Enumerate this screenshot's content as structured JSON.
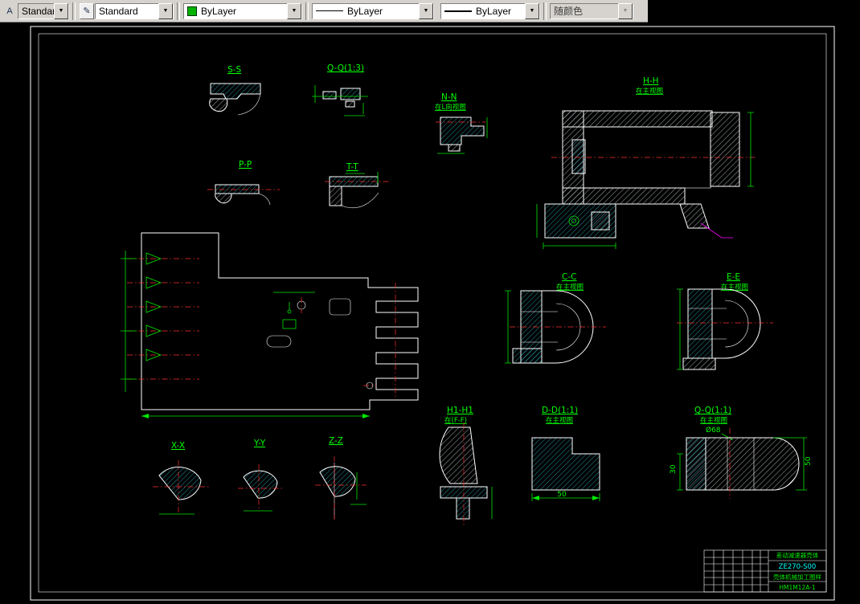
{
  "toolbar": {
    "text_style": {
      "value": "Standard"
    },
    "dim_style": {
      "value": "Standard"
    },
    "color": {
      "value": "ByLayer",
      "swatch": "#00b400"
    },
    "linetype": {
      "value": "ByLayer"
    },
    "lineweight": {
      "value": "ByLayer"
    },
    "plot_style": {
      "value": "随颜色"
    }
  },
  "views": {
    "ss": {
      "label": "S-S"
    },
    "qq13": {
      "label": "Q-Q(1:3)"
    },
    "nn": {
      "label": "N-N",
      "sub": "在L向视图"
    },
    "hh": {
      "label": "H-H",
      "sub": "在主视图"
    },
    "pp": {
      "label": "P-P"
    },
    "tt": {
      "label": "T-T"
    },
    "cc": {
      "label": "C-C",
      "sub": "在主视图"
    },
    "ee": {
      "label": "E-E",
      "sub": "在主视图"
    },
    "h1h1": {
      "label": "H1-H1",
      "sub": "在(F-F)"
    },
    "dd11": {
      "label": "D-D(1:1)",
      "sub": "在主视图",
      "dim_bottom": "50"
    },
    "qq11": {
      "label": "Q-Q(1:1)",
      "sub": "在主视图",
      "dim_dia": "Ø68",
      "dim_left": "30",
      "dim_right": "50"
    },
    "xx": {
      "label": "X-X"
    },
    "yy": {
      "label": "Y-Y"
    },
    "zz": {
      "label": "Z-Z"
    }
  },
  "title_block": {
    "product_name": "差动减速器壳体",
    "drawing_no": "ZE270-S00",
    "doc_name": "壳体机械加工图样",
    "part_no": "HM1M12A-1"
  },
  "colors": {
    "outline_white": "#ffffff",
    "line_green": "#00e800",
    "centerline_red": "#ff3030",
    "hatch_cyan": "#35d0e8",
    "annotation_magenta": "#ff00ff",
    "drawing_no_cyan": "#00ffff",
    "toolbar_bg": "#d6d3ce",
    "swatch_green": "#00b400"
  }
}
